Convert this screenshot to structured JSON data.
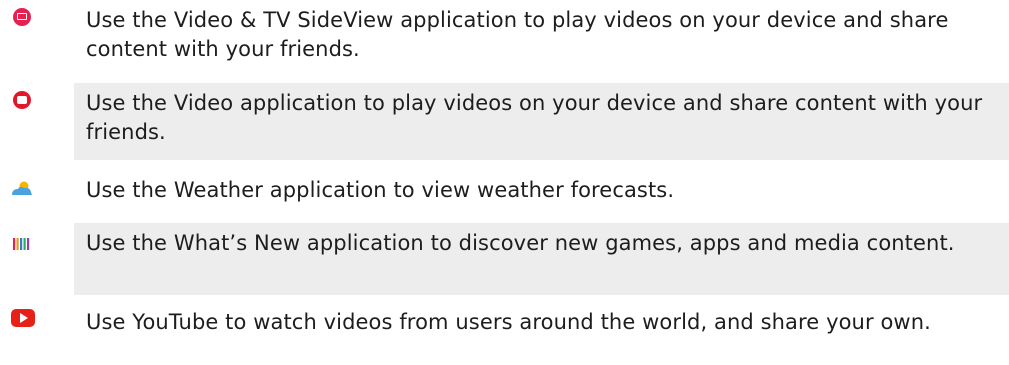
{
  "entries": [
    {
      "icon": "video-tv-sideview-icon",
      "text": "Use the Video & TV SideView application to play videos on your device and share content with your friends."
    },
    {
      "icon": "video-app-icon",
      "text": "Use the Video application to play videos on your device and share content with your friends."
    },
    {
      "icon": "weather-icon",
      "text": "Use the Weather application to view weather forecasts."
    },
    {
      "icon": "whats-new-icon",
      "text": "Use the What’s New application to discover new games, apps and media content."
    },
    {
      "icon": "youtube-icon",
      "text": "Use YouTube to watch videos from users around the world, and share your own."
    }
  ],
  "colors": {
    "row_shade": "#ededed",
    "sideview": "#e8204f",
    "video": "#e3172a",
    "youtube": "#e62117",
    "weather_sun": "#f5b400",
    "weather_cloud": "#4aa3df"
  }
}
